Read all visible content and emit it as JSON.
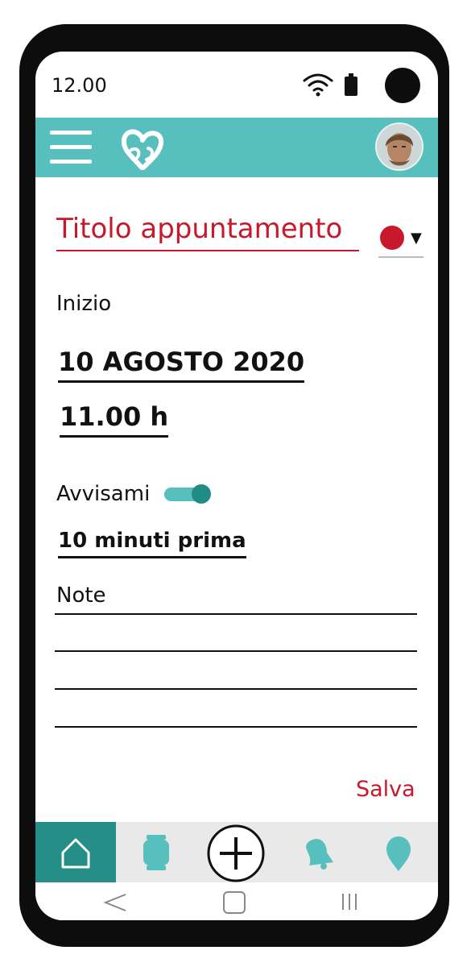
{
  "status_bar": {
    "time": "12.00"
  },
  "form": {
    "title_placeholder": "Titolo appuntamento",
    "start_label": "Inizio",
    "date": "10 AGOSTO 2020",
    "time": "11.00 h",
    "reminder_label": "Avvisami",
    "reminder_enabled": true,
    "reminder_value": "10 minuti prima",
    "notes_label": "Note",
    "save_label": "Salva",
    "selected_color": "#c8182c"
  },
  "colors": {
    "accent": "#57bfbd",
    "accent_dark": "#258e86",
    "primary_text": "#c8182c"
  },
  "bottom_nav": {
    "items": [
      "home-icon",
      "watch-icon",
      "add-icon",
      "bell-icon",
      "location-pin-icon"
    ],
    "active": "home-icon"
  },
  "system_nav": [
    "back-icon",
    "home-button-icon",
    "recents-icon"
  ]
}
